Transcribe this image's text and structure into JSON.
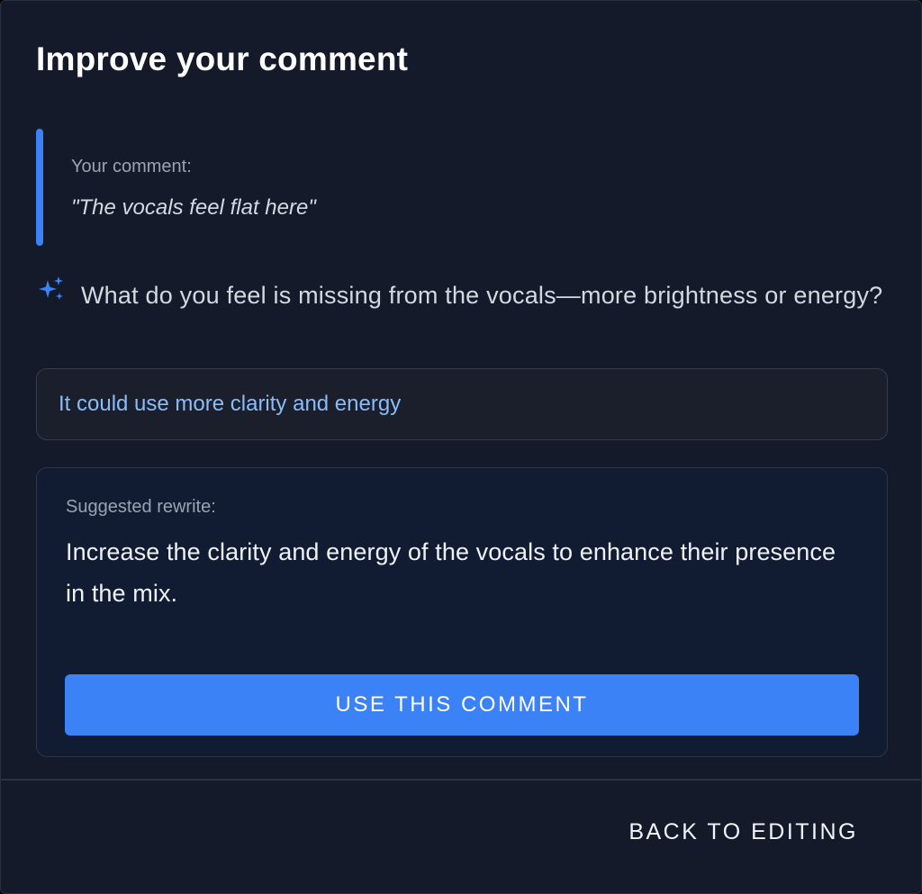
{
  "dialog": {
    "title": "Improve your comment"
  },
  "original_comment": {
    "label": "Your comment:",
    "text": "\"The vocals feel flat here\""
  },
  "question": {
    "icon": "sparkle-icon",
    "text": "What do you feel is missing from the vocals—more brightness or energy?"
  },
  "answer": {
    "value": "It could use more clarity and energy"
  },
  "suggestion": {
    "label": "Suggested rewrite:",
    "text": "Increase the clarity and energy of the vocals to enhance their presence in the mix.",
    "button_label": "USE THIS COMMENT"
  },
  "footer": {
    "back_label": "BACK TO EDITING"
  },
  "colors": {
    "background": "#141a29",
    "accent": "#3b82f6",
    "answer_text": "#8bbcf8",
    "card_background": "#111c33"
  }
}
